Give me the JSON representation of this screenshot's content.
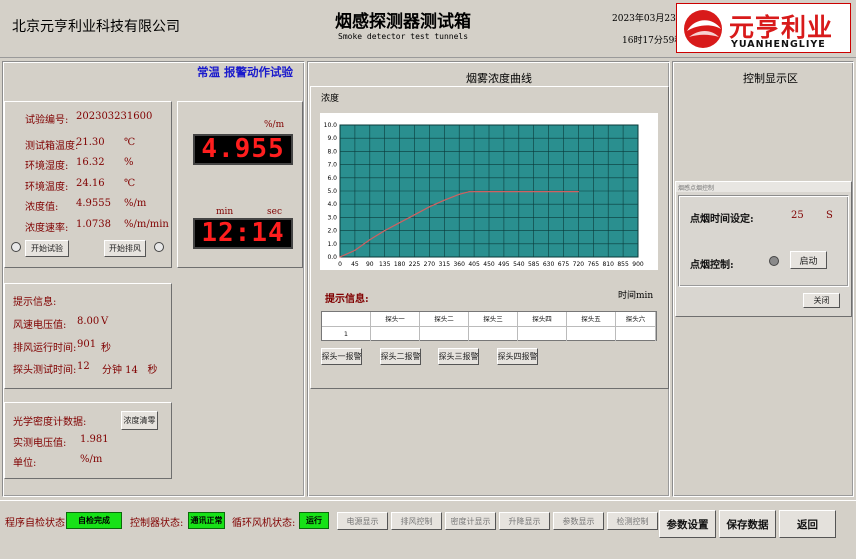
{
  "header": {
    "company": "北京元亨利业科技有限公司",
    "title": "烟感探测器测试箱",
    "subtitle": "Smoke detector test tunnels",
    "date": "2023年03月23日",
    "time": "16时17分59秒",
    "logo_text": "元亨利业",
    "logo_sub": "YUANHENGLIYE"
  },
  "left": {
    "mode_title": "常温 报警动作试验",
    "rows": [
      {
        "label": "试验编号:",
        "value": "202303231600",
        "unit": ""
      },
      {
        "label": "测试箱温度:",
        "value": "21.30",
        "unit": "℃"
      },
      {
        "label": "环境湿度:",
        "value": "16.32",
        "unit": "%"
      },
      {
        "label": "环境温度:",
        "value": "24.16",
        "unit": "℃"
      },
      {
        "label": "浓度值:",
        "value": "4.9555",
        "unit": "%/m"
      },
      {
        "label": "浓度速率:",
        "value": "1.0738",
        "unit": "%/m/min"
      }
    ],
    "start_test_label": "开始试验",
    "start_exhaust_label": "开始排风"
  },
  "leds": {
    "conc_unit": "%/m",
    "conc_value": "4.955",
    "min_label": "min",
    "sec_label": "sec",
    "time_value": "12:14"
  },
  "tips": {
    "title": "提示信息:",
    "rows": [
      {
        "label": "风速电压值:",
        "value": "8.00",
        "unit": "V"
      },
      {
        "label": "排风运行时间:",
        "value": "901",
        "unit": "秒"
      },
      {
        "label": "探头测试时间:",
        "value": "12",
        "unit": "分钟 14   秒"
      }
    ]
  },
  "optical": {
    "title": "光学密度计数据:",
    "clear_label": "浓度清零",
    "voltage_label": "实测电压值:",
    "voltage_value": "1.981",
    "unit_label": "单位:",
    "unit_value": "%/m"
  },
  "chart_section": {
    "title": "烟雾浓度曲线",
    "ylabel": "浓度",
    "xlabel": "时间min",
    "tips_label": "提示信息:",
    "table_headers": [
      "",
      "探头一",
      "探头二",
      "探头三",
      "探头四",
      "探头五",
      "探头六"
    ],
    "table_rows": [
      [
        "1",
        "",
        "",
        "",
        "",
        "",
        ""
      ]
    ],
    "probe_buttons": [
      "探头一报警",
      "探头二报警",
      "探头三报警",
      "探头四报警"
    ]
  },
  "chart_data": {
    "type": "line",
    "title": "",
    "xlabel": "时间min",
    "ylabel": "浓度",
    "xlim": [
      0,
      900
    ],
    "ylim": [
      0,
      10
    ],
    "x_ticks": [
      0,
      45,
      90,
      135,
      180,
      225,
      270,
      315,
      360,
      405,
      450,
      495,
      540,
      585,
      630,
      675,
      720,
      765,
      810,
      855,
      900
    ],
    "y_ticks": [
      "0.0",
      "1.0",
      "2.0",
      "3.0",
      "4.0",
      "5.0",
      "6.0",
      "7.0",
      "8.0",
      "9.0",
      "10.0"
    ],
    "grid": true,
    "series": [
      {
        "x": [
          0,
          45,
          90,
          135,
          180,
          225,
          270,
          315,
          360,
          390,
          420,
          720
        ],
        "y": [
          0,
          0.5,
          1.3,
          2.0,
          2.6,
          3.2,
          3.8,
          4.3,
          4.75,
          4.95,
          4.955,
          4.955
        ],
        "color": "#d06060"
      }
    ],
    "plot_bg": "#2a8f8f"
  },
  "right": {
    "title": "控制显示区",
    "dialog_title": "烟感点烟控制",
    "ignite_time_label": "点烟时间设定:",
    "ignite_time_value": "25",
    "ignite_time_unit": "S",
    "ignite_control_label": "点烟控制:",
    "start_label": "启动",
    "close_label": "关闭"
  },
  "footer": {
    "self_check_label": "程序自检状态:",
    "self_check_value": "自检完成",
    "controller_label": "控制器状态:",
    "controller_value": "通讯正常",
    "fan_label": "循环风机状态:",
    "fan_value": "运行",
    "buttons": [
      "电源显示",
      "排风控制",
      "密度计显示",
      "升降显示",
      "参数显示",
      "检测控制"
    ],
    "param_set_label": "参数设置",
    "save_label": "保存数据",
    "back_label": "返回"
  }
}
